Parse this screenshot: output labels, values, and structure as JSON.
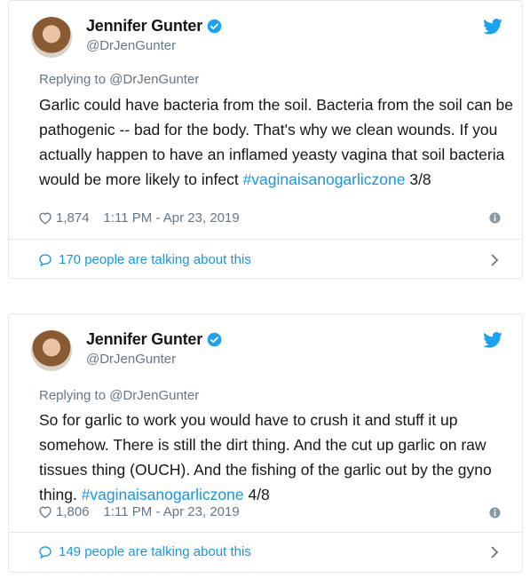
{
  "tweets": [
    {
      "author_name": "Jennifer Gunter",
      "handle": "@DrJenGunter",
      "replying_to": "Replying to @DrJenGunter",
      "text": "Garlic could have bacteria from the soil. Bacteria from the soil can be pathogenic -- bad for the body. That's why we clean wounds. If you actually happen to have an inflamed yeasty vagina that soil bacteria would be more likely to infect ",
      "hashtag": "#vaginaisanogarliczone",
      "suffix": " 3/8",
      "likes": "1,874",
      "timestamp": "1:11 PM - Apr 23, 2019",
      "talking": "170 people are talking about this"
    },
    {
      "author_name": "Jennifer Gunter",
      "handle": "@DrJenGunter",
      "replying_to": "Replying to @DrJenGunter",
      "text": "So for garlic to work you would have to crush it and stuff it up somehow. There is still the dirt thing. And the cut up garlic on raw tissues thing (OUCH). And the fishing of the garlic out by the gyno thing. ",
      "hashtag": "#vaginaisanogarliczone",
      "suffix": " 4/8",
      "likes": "1,806",
      "timestamp": "1:11 PM - Apr 23, 2019",
      "talking": "149 people are talking about this"
    }
  ],
  "icons": {
    "verified": "verified-badge-icon",
    "bird": "twitter-bird-icon",
    "heart": "heart-icon",
    "info": "info-icon",
    "bubble": "chat-bubble-icon",
    "chevron": "chevron-right-icon"
  },
  "colors": {
    "link": "#1b95e0",
    "muted": "#657786",
    "border": "#e1e8ed",
    "text": "#14171a"
  }
}
